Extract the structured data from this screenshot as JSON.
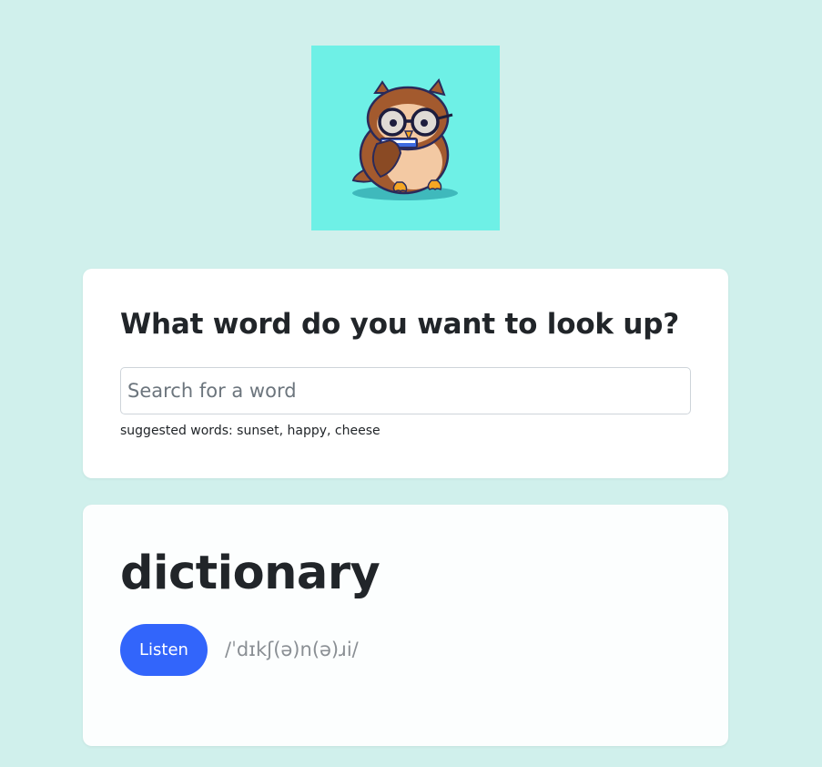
{
  "logo": {
    "icon": "owl-with-glasses-and-book",
    "background_color": "#6ef0e6"
  },
  "search": {
    "title": "What word do you want to look up?",
    "placeholder": "Search for a word",
    "value": "",
    "suggestions_text": "suggested words: sunset, happy, cheese"
  },
  "result": {
    "word": "dictionary",
    "listen_label": "Listen",
    "phonetic": "/ˈdɪkʃ(ə)n(ə)ɹi/"
  },
  "colors": {
    "page_background": "#d0f0ec",
    "accent_button": "#3265fb",
    "card_background": "#ffffff"
  }
}
